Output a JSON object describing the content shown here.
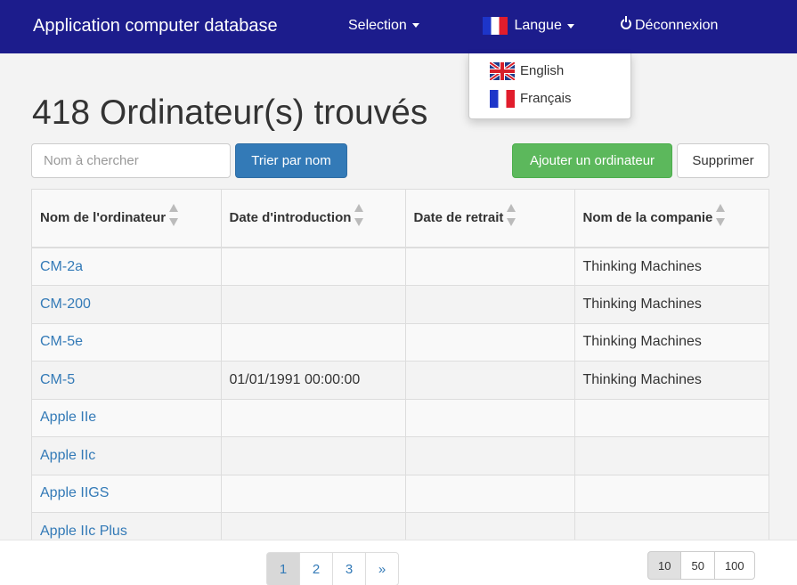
{
  "navbar": {
    "brand": "Application computer database",
    "selection_label": "Selection",
    "language_label": "Langue",
    "logout_label": "Déconnexion",
    "color": "#1c1c8c"
  },
  "language_menu": {
    "items": [
      {
        "label": "English",
        "icon": "uk-flag-icon"
      },
      {
        "label": "Français",
        "icon": "fr-flag-icon"
      }
    ]
  },
  "heading": "418 Ordinateur(s) trouvés",
  "search": {
    "placeholder": "Nom à chercher",
    "value": ""
  },
  "buttons": {
    "sort": "Trier par nom",
    "add": "Ajouter un ordinateur",
    "delete": "Supprimer"
  },
  "table": {
    "columns": [
      "Nom de l'ordinateur",
      "Date d'introduction",
      "Date de retrait",
      "Nom de la companie"
    ],
    "rows": [
      {
        "name": "CM-2a",
        "introduced": "",
        "discontinued": "",
        "company": "Thinking Machines"
      },
      {
        "name": "CM-200",
        "introduced": "",
        "discontinued": "",
        "company": "Thinking Machines"
      },
      {
        "name": "CM-5e",
        "introduced": "",
        "discontinued": "",
        "company": "Thinking Machines"
      },
      {
        "name": "CM-5",
        "introduced": "01/01/1991 00:00:00",
        "discontinued": "",
        "company": "Thinking Machines"
      },
      {
        "name": "Apple IIe",
        "introduced": "",
        "discontinued": "",
        "company": ""
      },
      {
        "name": "Apple IIc",
        "introduced": "",
        "discontinued": "",
        "company": ""
      },
      {
        "name": "Apple IIGS",
        "introduced": "",
        "discontinued": "",
        "company": ""
      },
      {
        "name": "Apple IIc Plus",
        "introduced": "",
        "discontinued": "",
        "company": ""
      }
    ]
  },
  "pagination": {
    "pages": [
      "1",
      "2",
      "3"
    ],
    "next": "»",
    "current": "1"
  },
  "page_size": {
    "options": [
      "10",
      "50",
      "100"
    ],
    "selected": "10"
  }
}
